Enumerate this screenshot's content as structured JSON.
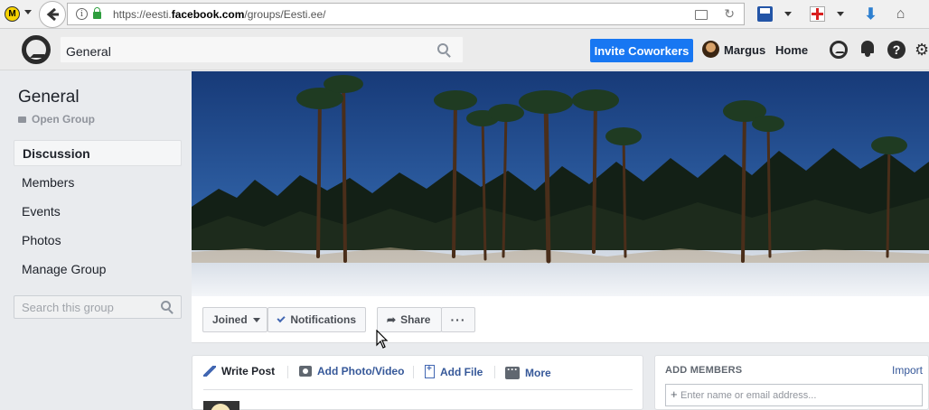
{
  "browser": {
    "logo_letter": "M",
    "url_prefix": "https://eesti.",
    "url_domain": "facebook.com",
    "url_suffix": "/groups/Eesti.ee/"
  },
  "topbar": {
    "search_value": "General",
    "invite_label": "Invite Coworkers",
    "user_name": "Margus",
    "home_label": "Home",
    "help_glyph": "?",
    "gear_glyph": "⚙",
    "accent_color": "#1877f2"
  },
  "sidebar": {
    "group_name": "General",
    "group_type": "Open Group",
    "items": [
      {
        "label": "Discussion",
        "active": true
      },
      {
        "label": "Members",
        "active": false
      },
      {
        "label": "Events",
        "active": false
      },
      {
        "label": "Photos",
        "active": false
      },
      {
        "label": "Manage Group",
        "active": false
      }
    ],
    "search_placeholder": "Search this group"
  },
  "group_actions": {
    "joined_label": "Joined",
    "notifications_label": "Notifications",
    "share_label": "Share",
    "more_label": "···"
  },
  "composer": {
    "tabs": [
      {
        "label": "Write Post",
        "icon": "pencil-icon"
      },
      {
        "label": "Add Photo/Video",
        "icon": "camera-icon"
      },
      {
        "label": "Add File",
        "icon": "file-icon"
      },
      {
        "label": "More",
        "icon": "more-icon"
      }
    ]
  },
  "add_members": {
    "title": "ADD MEMBERS",
    "import_label": "Import",
    "placeholder": "Enter name or email address..."
  }
}
